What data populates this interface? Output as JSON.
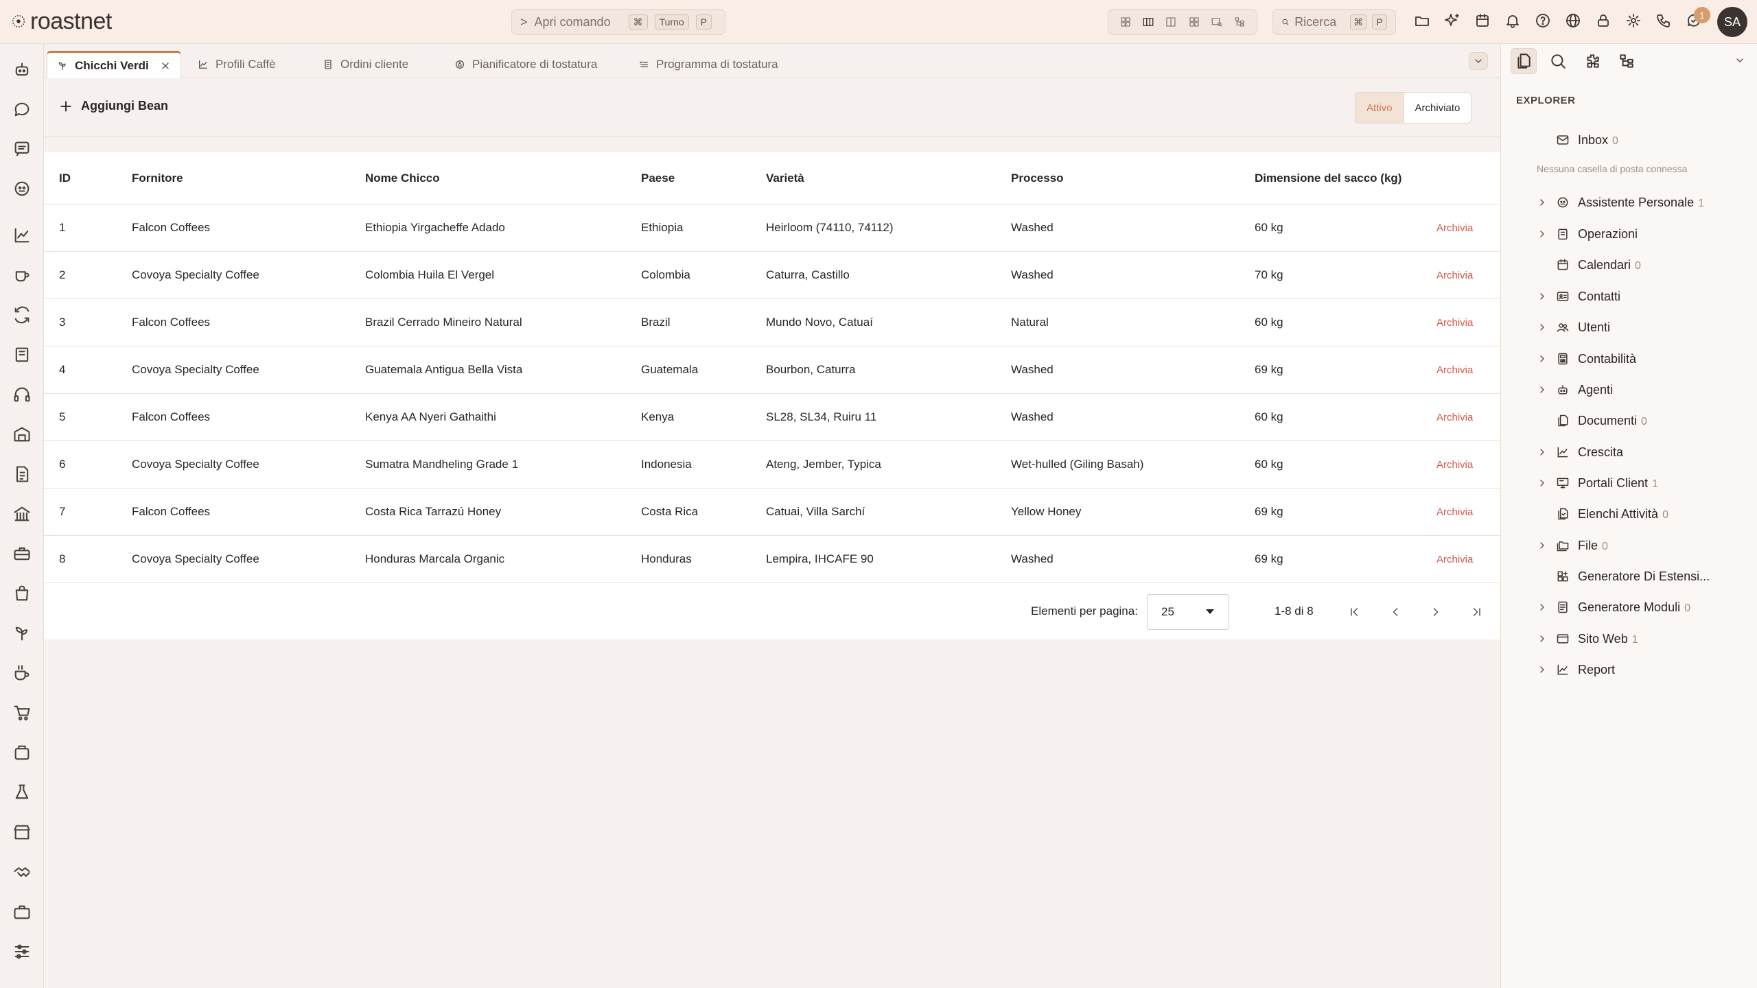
{
  "app": {
    "name": "roastnet"
  },
  "header": {
    "command": {
      "prompt": ">",
      "label": "Apri comando",
      "key1": "⌘",
      "key2": "Turno",
      "key3": "P"
    },
    "search": {
      "label": "Ricerca",
      "key1": "⌘",
      "key2": "P"
    },
    "notification_badge": "1",
    "avatar": "SA"
  },
  "tabs": [
    {
      "label": "Chicchi Verdi",
      "icon": "sprout-icon",
      "active": true
    },
    {
      "label": "Profili Caffè",
      "icon": "chart-icon"
    },
    {
      "label": "Ordini cliente",
      "icon": "document-icon"
    },
    {
      "label": "Pianificatore di tostatura",
      "icon": "flame-icon"
    },
    {
      "label": "Programma di tostatura",
      "icon": "list-icon"
    }
  ],
  "toolbar": {
    "add_label": "Aggiungi Bean",
    "filter_active": "Attivo",
    "filter_archived": "Archiviato"
  },
  "table": {
    "columns": [
      "ID",
      "Fornitore",
      "Nome Chicco",
      "Paese",
      "Varietà",
      "Processo",
      "Dimensione del sacco (kg)"
    ],
    "action_label": "Archivia",
    "rows": [
      {
        "id": "1",
        "supplier": "Falcon Coffees",
        "name": "Ethiopia Yirgacheffe Adado",
        "country": "Ethiopia",
        "variety": "Heirloom (74110, 74112)",
        "process": "Washed",
        "bag": "60 kg"
      },
      {
        "id": "2",
        "supplier": "Covoya Specialty Coffee",
        "name": "Colombia Huila El Vergel",
        "country": "Colombia",
        "variety": "Caturra, Castillo",
        "process": "Washed",
        "bag": "70 kg"
      },
      {
        "id": "3",
        "supplier": "Falcon Coffees",
        "name": "Brazil Cerrado Mineiro Natural",
        "country": "Brazil",
        "variety": "Mundo Novo, Catuaí",
        "process": "Natural",
        "bag": "60 kg"
      },
      {
        "id": "4",
        "supplier": "Covoya Specialty Coffee",
        "name": "Guatemala Antigua Bella Vista",
        "country": "Guatemala",
        "variety": "Bourbon, Caturra",
        "process": "Washed",
        "bag": "69 kg"
      },
      {
        "id": "5",
        "supplier": "Falcon Coffees",
        "name": "Kenya AA Nyeri Gathaithi",
        "country": "Kenya",
        "variety": "SL28, SL34, Ruiru 11",
        "process": "Washed",
        "bag": "60 kg"
      },
      {
        "id": "6",
        "supplier": "Covoya Specialty Coffee",
        "name": "Sumatra Mandheling Grade 1",
        "country": "Indonesia",
        "variety": "Ateng, Jember, Typica",
        "process": "Wet-hulled (Giling Basah)",
        "bag": "60 kg"
      },
      {
        "id": "7",
        "supplier": "Falcon Coffees",
        "name": "Costa Rica Tarrazú Honey",
        "country": "Costa Rica",
        "variety": "Catuai, Villa Sarchí",
        "process": "Yellow Honey",
        "bag": "69 kg"
      },
      {
        "id": "8",
        "supplier": "Covoya Specialty Coffee",
        "name": "Honduras Marcala Organic",
        "country": "Honduras",
        "variety": "Lempira, IHCAFE 90",
        "process": "Washed",
        "bag": "69 kg"
      }
    ]
  },
  "pagination": {
    "per_page_label": "Elementi per pagina:",
    "per_page": "25",
    "range": "1-8 di 8"
  },
  "explorer": {
    "title": "EXPLORER",
    "no_mailbox": "Nessuna casella di posta connessa",
    "items": [
      {
        "label": "Inbox",
        "count": "0"
      },
      {
        "label": "Assistente Personale",
        "count": "1"
      },
      {
        "label": "Operazioni",
        "count": ""
      },
      {
        "label": "Calendari",
        "count": "0"
      },
      {
        "label": "Contatti",
        "count": ""
      },
      {
        "label": "Utenti",
        "count": ""
      },
      {
        "label": "Contabilità",
        "count": ""
      },
      {
        "label": "Agenti",
        "count": ""
      },
      {
        "label": "Documenti",
        "count": "0"
      },
      {
        "label": "Crescita",
        "count": ""
      },
      {
        "label": "Portali Client",
        "count": "1"
      },
      {
        "label": "Elenchi Attività",
        "count": "0"
      },
      {
        "label": "File",
        "count": "0"
      },
      {
        "label": "Generatore Di Estensi...",
        "count": ""
      },
      {
        "label": "Generatore Moduli",
        "count": "0"
      },
      {
        "label": "Sito Web",
        "count": "1"
      },
      {
        "label": "Report",
        "count": ""
      }
    ]
  },
  "colors": {
    "accent": "#c47a4a",
    "danger": "#d0584a",
    "header_bg": "#f9ede6"
  }
}
